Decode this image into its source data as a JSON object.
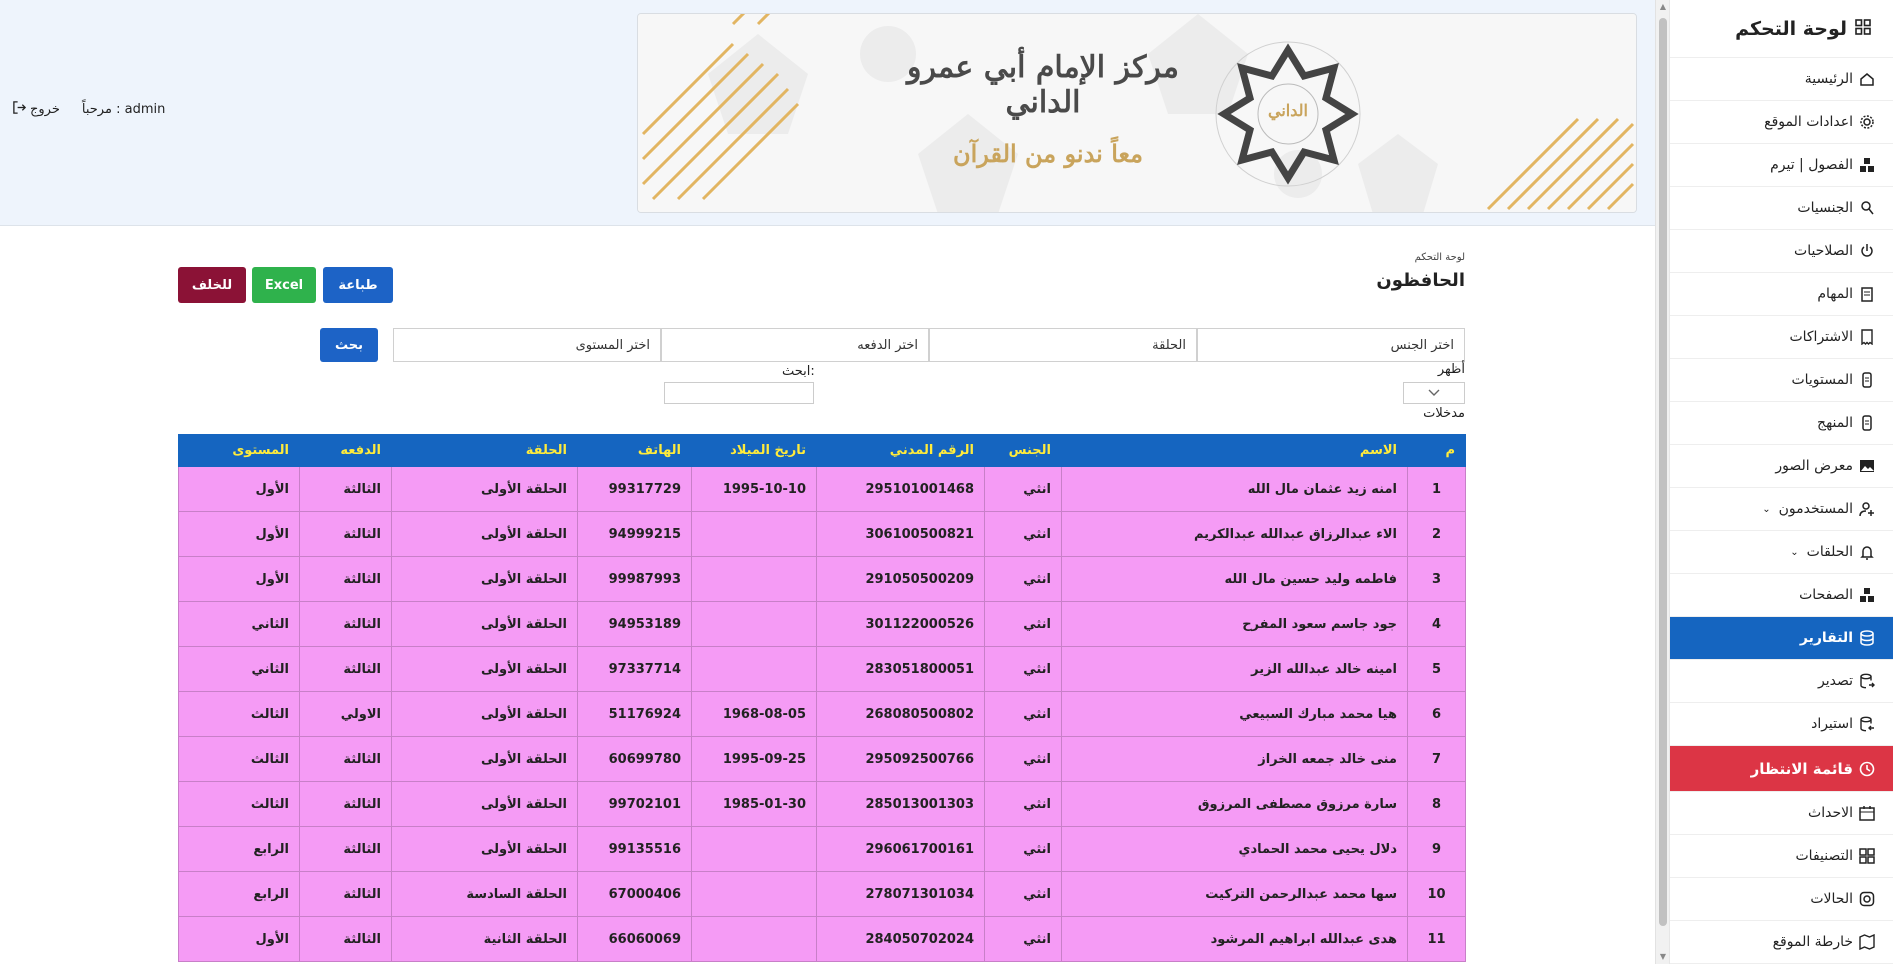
{
  "sidebar": {
    "title": "لوحة التحكم",
    "items": [
      {
        "label": "الرئيسية",
        "icon": "home-icon"
      },
      {
        "label": "اعدادات الموقع",
        "icon": "gear-icon"
      },
      {
        "label": "الفصول | تيرم",
        "icon": "cubes-icon"
      },
      {
        "label": "الجنسيات",
        "icon": "location-icon"
      },
      {
        "label": "الصلاحيات",
        "icon": "power-icon"
      },
      {
        "label": "المهام",
        "icon": "clipboard-icon"
      },
      {
        "label": "الاشتراكات",
        "icon": "receipt-icon"
      },
      {
        "label": "المستويات",
        "icon": "file-icon"
      },
      {
        "label": "المنهج",
        "icon": "file-icon"
      },
      {
        "label": "معرض الصور",
        "icon": "image-icon"
      },
      {
        "label": "المستخدمون",
        "icon": "user-plus-icon"
      },
      {
        "label": "الحلقات",
        "icon": "bell-icon"
      },
      {
        "label": "الصفحات",
        "icon": "cubes-icon"
      },
      {
        "label": "التقارير",
        "icon": "database-icon"
      },
      {
        "label": "تصدير",
        "icon": "export-icon"
      },
      {
        "label": "استيراد",
        "icon": "import-icon"
      },
      {
        "label": "قائمة الانتظار",
        "icon": "clock-icon"
      },
      {
        "label": "الاحداث",
        "icon": "calendar-icon"
      },
      {
        "label": "التصنيفات",
        "icon": "grid-icon"
      },
      {
        "label": "الحالات",
        "icon": "instagram-icon"
      },
      {
        "label": "خارطة الموقع",
        "icon": "map-icon"
      }
    ]
  },
  "header": {
    "welcome": "مرحباً : admin",
    "logout": "خروج",
    "banner_title": "مركز الإمام أبي عمرو الداني",
    "banner_subtitle": "معاً ندنو من القرآن",
    "banner_seal": "الداني"
  },
  "page": {
    "breadcrumb": "لوحة التحكم",
    "title": "الحافظون",
    "buttons": {
      "print": "طباعة",
      "excel": "Excel",
      "back": "للخلف",
      "search": "بحث"
    },
    "filters": {
      "gender": "اختر الجنس",
      "halaqa": "الحلقة",
      "payment": "اختر الدفعه",
      "level": "اختر المستوى"
    },
    "show_label": "أظهر",
    "entries_label": "مدخلات",
    "search_label": "ابحث:"
  },
  "table": {
    "headers": [
      "م",
      "الاسم",
      "الجنس",
      "الرقم المدني",
      "تاريخ الميلاد",
      "الهاتف",
      "الحلقة",
      "الدفعه",
      "المستوى"
    ],
    "rows": [
      [
        "1",
        "امنه زيد عثمان مال الله",
        "انثي",
        "295101001468",
        "1995-10-10",
        "99317729",
        "الحلقة الأولى",
        "الثالثة",
        "الأول"
      ],
      [
        "2",
        "الاء عبدالرزاق عبدالله عبدالكريم",
        "انثي",
        "306100500821",
        "",
        "94999215",
        "الحلقة الأولى",
        "الثالثة",
        "الأول"
      ],
      [
        "3",
        "فاطمه وليد حسين مال الله",
        "انثي",
        "291050500209",
        "",
        "99987993",
        "الحلقة الأولى",
        "الثالثة",
        "الأول"
      ],
      [
        "4",
        "جود جاسم سعود المفرح",
        "انثي",
        "301122000526",
        "",
        "94953189",
        "الحلقة الأولى",
        "الثالثة",
        "الثاني"
      ],
      [
        "5",
        "امينه خالد عبدالله الزير",
        "انثي",
        "283051800051",
        "",
        "97337714",
        "الحلقة الأولى",
        "الثالثة",
        "الثاني"
      ],
      [
        "6",
        "هيا محمد مبارك السبيعي",
        "انثي",
        "268080500802",
        "1968-08-05",
        "51176924",
        "الحلقة الأولى",
        "الاولي",
        "الثالث"
      ],
      [
        "7",
        "منى خالد جمعه الخراز",
        "انثي",
        "295092500766",
        "1995-09-25",
        "60699780",
        "الحلقة الأولى",
        "الثالثة",
        "الثالث"
      ],
      [
        "8",
        "سارة مرزوق مصطفى المرزوق",
        "انثي",
        "285013001303",
        "1985-01-30",
        "99702101",
        "الحلقة الأولى",
        "الثالثة",
        "الثالث"
      ],
      [
        "9",
        "دلال يحيى محمد الحمادي",
        "انثي",
        "296061700161",
        "",
        "99135516",
        "الحلقة الأولى",
        "الثالثة",
        "الرابع"
      ],
      [
        "10",
        "سها محمد عبدالرحمن التركيت",
        "انثي",
        "278071301034",
        "",
        "67000406",
        "الحلقة السادسة",
        "الثالثة",
        "الرابع"
      ],
      [
        "11",
        "هدى عبدالله ابراهيم المرشود",
        "انثي",
        "284050702024",
        "",
        "66060069",
        "الحلقة الثانية",
        "الثالثة",
        "الأول"
      ]
    ]
  },
  "colors": {
    "primary": "#1565c0",
    "header_text": "#ffeb3b",
    "row_bg": "#f59bf5",
    "danger": "#dc3545",
    "success": "#2fb24c",
    "back": "#8b1236"
  }
}
